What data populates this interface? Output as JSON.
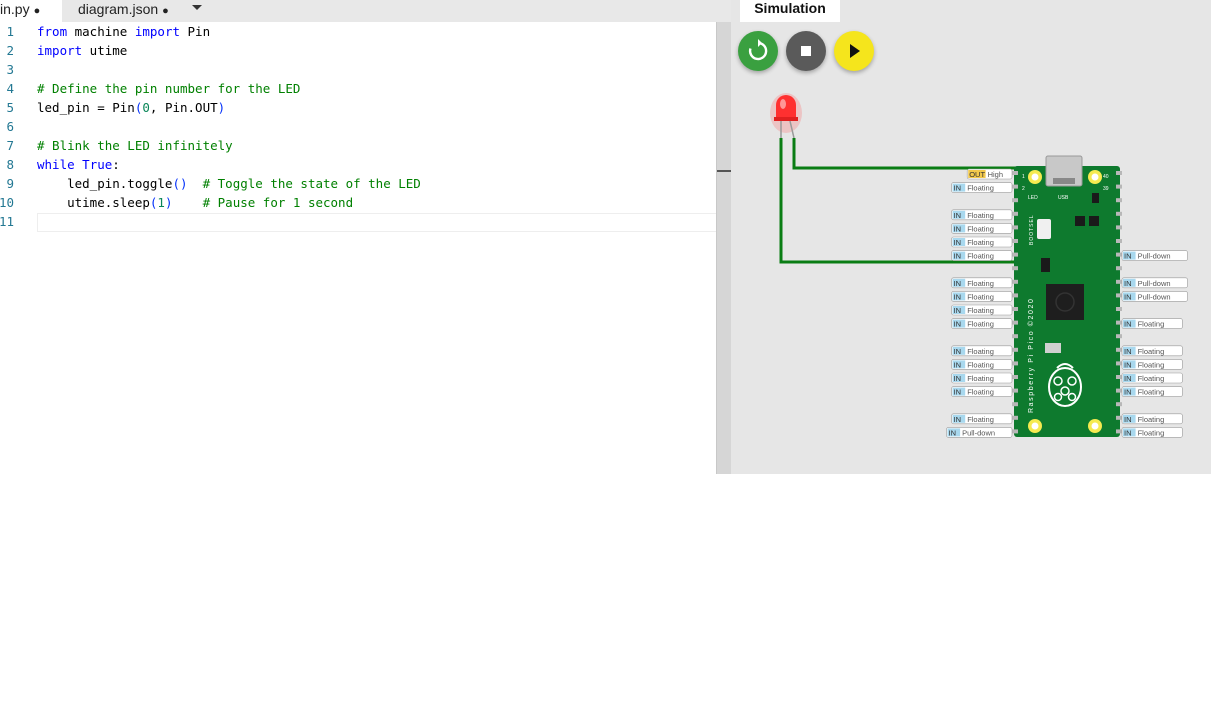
{
  "editor": {
    "tabs": [
      {
        "label": "in.py",
        "modified": "●"
      },
      {
        "label": "diagram.json",
        "modified": "●"
      }
    ],
    "line_numbers": [
      "1",
      "2",
      "3",
      "4",
      "5",
      "6",
      "7",
      "8",
      "9",
      "10",
      "11"
    ],
    "code": {
      "l1": {
        "kw1": "from",
        "t1": " machine ",
        "kw2": "import",
        "t2": " Pin"
      },
      "l2": {
        "kw1": "import",
        "t1": " utime"
      },
      "l4": {
        "c": "# Define the pin number for the LED"
      },
      "l5": {
        "t1": "led_pin = Pin",
        "p1": "(",
        "n1": "0",
        "t2": ", Pin.OUT",
        "p2": ")"
      },
      "l7": {
        "c": "# Blink the LED infinitely"
      },
      "l8": {
        "kw1": "while",
        "t1": " ",
        "kw2": "True",
        "t2": ":"
      },
      "l9": {
        "t1": "    led_pin.toggle",
        "p1": "()",
        "t2": "  ",
        "c": "# Toggle the state of the LED"
      },
      "l10": {
        "t1": "    utime.sleep",
        "p1": "(",
        "n1": "1",
        "p2": ")",
        "t2": "    ",
        "c": "# Pause for 1 second"
      }
    }
  },
  "simulation": {
    "tab_label": "Simulation",
    "controls": {
      "restart": "restart-icon",
      "stop": "stop-icon",
      "play": "play-icon"
    },
    "board_text": {
      "side": "Raspberry Pi Pico ©2020",
      "bootsel": "BOOTSEL",
      "led": "LED",
      "usb": "USB",
      "p1": "1",
      "p2": "2",
      "p39": "39",
      "p40": "40"
    },
    "pin_labels_left": [
      {
        "mode": "OUT",
        "state": "High"
      },
      {
        "mode": "IN",
        "state": "Floating"
      },
      {
        "mode": "IN",
        "state": "Floating"
      },
      {
        "mode": "IN",
        "state": "Floating"
      },
      {
        "mode": "IN",
        "state": "Floating"
      },
      {
        "mode": "IN",
        "state": "Floating"
      },
      {
        "mode": "IN",
        "state": "Floating"
      },
      {
        "mode": "IN",
        "state": "Floating"
      },
      {
        "mode": "IN",
        "state": "Floating"
      },
      {
        "mode": "IN",
        "state": "Floating"
      },
      {
        "mode": "IN",
        "state": "Floating"
      },
      {
        "mode": "IN",
        "state": "Floating"
      },
      {
        "mode": "IN",
        "state": "Floating"
      },
      {
        "mode": "IN",
        "state": "Floating"
      },
      {
        "mode": "IN",
        "state": "Floating"
      },
      {
        "mode": "IN",
        "state": "Pull-down"
      }
    ],
    "pin_labels_right": [
      {
        "mode": "IN",
        "state": "Pull-down"
      },
      {
        "mode": "IN",
        "state": "Pull-down"
      },
      {
        "mode": "IN",
        "state": "Pull-down"
      },
      {
        "mode": "IN",
        "state": "Floating"
      },
      {
        "mode": "IN",
        "state": "Floating"
      },
      {
        "mode": "IN",
        "state": "Floating"
      },
      {
        "mode": "IN",
        "state": "Floating"
      },
      {
        "mode": "IN",
        "state": "Floating"
      },
      {
        "mode": "IN",
        "state": "Floating"
      },
      {
        "mode": "IN",
        "state": "Floating"
      }
    ],
    "colors": {
      "board": "#0e7a2e",
      "wire": "#0a7d14",
      "led": "#ff3030",
      "in_badge": "#a8d8ee",
      "out_badge": "#f2c94c",
      "restart": "#3aa040",
      "stop": "#5a5a5a",
      "play": "#f5e51c"
    }
  }
}
